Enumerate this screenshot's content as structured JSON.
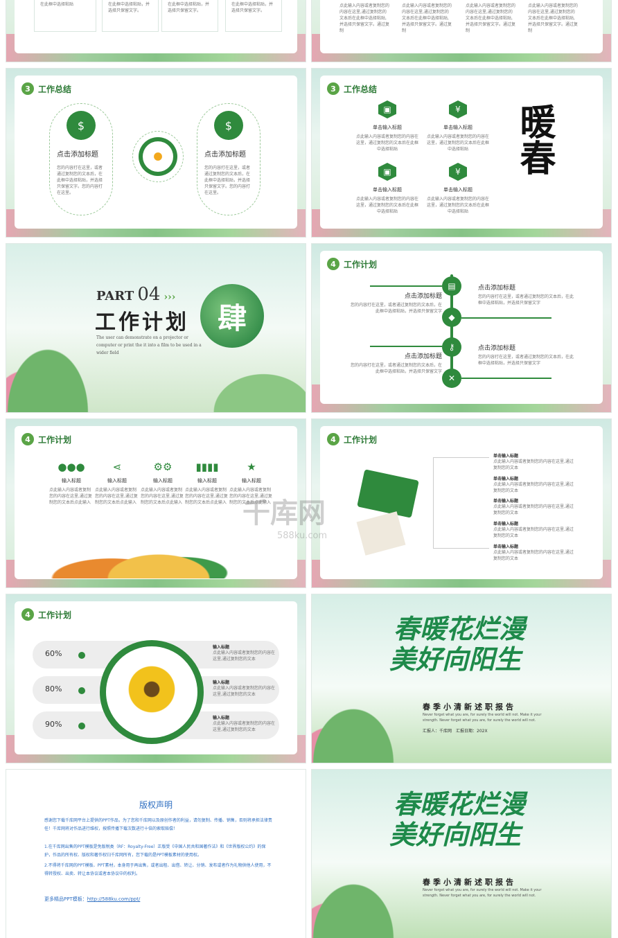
{
  "colors": {
    "accent": "#2f8a3d",
    "accent_light": "#5aa446",
    "link": "#2f6fc1"
  },
  "s1": {
    "texts": [
      "在此框中选择粘贴",
      "在此框中选择粘贴，并选择只保留文字。",
      "在此框中选择粘贴，并选择只保留文字。",
      "在此框中选择粘贴，并选择只保留文字。"
    ]
  },
  "s2": {
    "col_text": "点此输入内容或者复制您的内容在这里,通过复制您的文本后在此框中选择粘贴,并选择只保留文字。通过复制"
  },
  "s3": {
    "num": "3",
    "title": "工作总结",
    "left_title": "点击添加标题",
    "right_title": "点击添加标题",
    "body": "您的内容打在这里，或者通过复制您的文本后，在此框中选择粘贴，并选择只保留文字。您的内容打在这里。",
    "icon": "$"
  },
  "s4": {
    "num": "3",
    "title": "工作总结",
    "item_title": "单击输入标题",
    "item_body": "点此输入内容或者复制您的内容在这里，通过复制您的文本后在此框中选择粘贴",
    "logo": "暖春",
    "icons": [
      "android-icon",
      "yen-icon",
      "android-icon",
      "yen-icon"
    ]
  },
  "s5": {
    "part": "PART",
    "num": "04",
    "title": "工作计划",
    "seal": "肆",
    "desc": "The user can demonstrate on a projector or computer or print the it into a film to be used in a wider field"
  },
  "s6": {
    "num": "4",
    "title": "工作计划",
    "item_title": "点击添加标题",
    "item_body": "您的内容打在这里，或者通过复制您的文本后，在此框中选择粘贴，并选择只保留文字"
  },
  "s7": {
    "num": "4",
    "title": "工作计划",
    "items": [
      {
        "label": "输入标题",
        "icon": "people-icon"
      },
      {
        "label": "输入标题",
        "icon": "share-icon"
      },
      {
        "label": "输入标题",
        "icon": "gears-icon"
      },
      {
        "label": "输入标题",
        "icon": "bars-icon"
      },
      {
        "label": "输入标题",
        "icon": "star-icon"
      }
    ],
    "item_body": "点此输入内容或者复制您的内容在这里,通过复制您的文本后点此输入"
  },
  "s8": {
    "num": "4",
    "title": "工作计划",
    "item_title": "单击输入标题",
    "item_body": "点此输入内容或者复制您的内容在这里,通过复制您的文本",
    "watermark": "千库网",
    "watermark_url": "588ku.com"
  },
  "s9": {
    "num": "4",
    "title": "工作计划",
    "rows": [
      {
        "pct": "60%",
        "title": "输入标题"
      },
      {
        "pct": "80%",
        "title": "输入标题"
      },
      {
        "pct": "90%",
        "title": "输入标题"
      }
    ],
    "row_body": "点此输入内容或者复制您的内容在这里,通过复制您的文本"
  },
  "s10": {
    "headline1": "春暖花烂漫",
    "headline2": "美好向阳生",
    "subtitle": "春季小清新述职报告",
    "eng": "Never forget what you are, for surely the world will not. Make it your strength. Never forget what you are, for surely the world will not.",
    "reporter": "汇报人：千库网",
    "date": "汇报日期：202X"
  },
  "s11": {
    "title": "版权声明",
    "p1": "感谢您下载千库网平台上提供的PPT作品，为了您和千库网以及原创作者的利益，请勿复制、传播、销售，否则将承担法律责任！千库网将对作品进行维权，按照传播下载次数进行十倍的索取赔偿！",
    "p2": "1.在千库网出售的PPT模板是免版税类（RF：Royalty-Free）正版受《中国人民共和国著作法》和《世界版权公约》的保护，作品的所有权、版权和著作权归千库网所有，您下载的是PPT模板素材的使用权。",
    "p3": "2.不得将千库网的PPT模板、PPT素材，本身用于再出售，或者出租、出借、转让、分销、发布或者作为礼物供他人使用，不得转授权、出卖、转让本协议或者本协议中的权利。",
    "more": "更多精品PPT模板：",
    "url": "http://588ku.com/ppt/"
  },
  "s12": {
    "headline1": "春暖花烂漫",
    "headline2": "美好向阳生",
    "subtitle": "春季小清新述职报告",
    "eng": "Never forget what you are, for surely the world will not. Make it your strength. Never forget what you are, for surely the world will not."
  }
}
